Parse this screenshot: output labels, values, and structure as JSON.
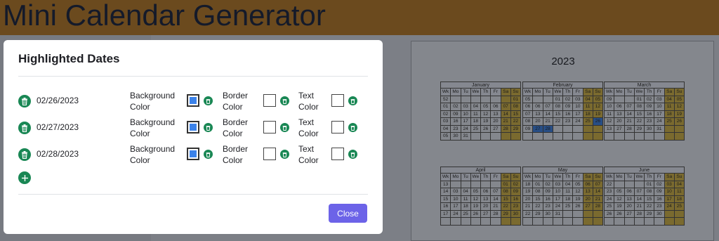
{
  "app": {
    "title": "Mini Calendar Generator"
  },
  "modal": {
    "title": "Highlighted Dates",
    "close_label": "Close",
    "rows": [
      {
        "date": "02/26/2023",
        "bg_label": "Background Color",
        "bg_color": "#3b82ea",
        "border_label": "Border Color",
        "text_label": "Text Color"
      },
      {
        "date": "02/27/2023",
        "bg_label": "Background Color",
        "bg_color": "#3b82ea",
        "border_label": "Border Color",
        "text_label": "Text Color"
      },
      {
        "date": "02/28/2023",
        "bg_label": "Background Color",
        "bg_color": "#3b82ea",
        "border_label": "Border Color",
        "text_label": "Text Color"
      }
    ]
  },
  "calendar": {
    "year": "2023",
    "weekday_headers": [
      "Wk",
      "Mo",
      "Tu",
      "We",
      "Th",
      "Fr",
      "Sa",
      "Su"
    ],
    "months": [
      {
        "name": "January",
        "weeks": [
          [
            "52",
            "",
            "",
            "",
            "",
            "",
            "",
            "01"
          ],
          [
            "01",
            "02",
            "03",
            "04",
            "05",
            "06",
            "07",
            "08"
          ],
          [
            "02",
            "09",
            "10",
            "11",
            "12",
            "13",
            "14",
            "15"
          ],
          [
            "03",
            "16",
            "17",
            "18",
            "19",
            "20",
            "21",
            "22"
          ],
          [
            "04",
            "23",
            "24",
            "25",
            "26",
            "27",
            "28",
            "29"
          ],
          [
            "05",
            "30",
            "31",
            "",
            "",
            "",
            "",
            ""
          ]
        ]
      },
      {
        "name": "February",
        "weeks": [
          [
            "05",
            "",
            "",
            "01",
            "02",
            "03",
            "04",
            "05"
          ],
          [
            "06",
            "06",
            "07",
            "08",
            "09",
            "10",
            "11",
            "12"
          ],
          [
            "07",
            "13",
            "14",
            "15",
            "16",
            "17",
            "18",
            "19"
          ],
          [
            "08",
            "20",
            "21",
            "22",
            "23",
            "24",
            "25",
            "26"
          ],
          [
            "09",
            "27",
            "28",
            "",
            "",
            "",
            "",
            ""
          ],
          [
            "",
            "",
            "",
            "",
            "",
            "",
            "",
            ""
          ]
        ]
      },
      {
        "name": "March",
        "weeks": [
          [
            "09",
            "",
            "",
            "01",
            "02",
            "03",
            "04",
            "05"
          ],
          [
            "10",
            "06",
            "07",
            "08",
            "09",
            "10",
            "11",
            "12"
          ],
          [
            "11",
            "13",
            "14",
            "15",
            "16",
            "17",
            "18",
            "19"
          ],
          [
            "12",
            "20",
            "21",
            "22",
            "23",
            "24",
            "25",
            "26"
          ],
          [
            "13",
            "27",
            "28",
            "29",
            "30",
            "31",
            "",
            ""
          ],
          [
            "",
            "",
            "",
            "",
            "",
            "",
            "",
            ""
          ]
        ]
      },
      {
        "name": "April",
        "weeks": [
          [
            "13",
            "",
            "",
            "",
            "",
            "",
            "01",
            "02"
          ],
          [
            "14",
            "03",
            "04",
            "05",
            "06",
            "07",
            "08",
            "09"
          ],
          [
            "15",
            "10",
            "11",
            "12",
            "13",
            "14",
            "15",
            "16"
          ],
          [
            "16",
            "17",
            "18",
            "19",
            "20",
            "21",
            "22",
            "23"
          ],
          [
            "17",
            "24",
            "25",
            "26",
            "27",
            "28",
            "29",
            "30"
          ],
          [
            "",
            "",
            "",
            "",
            "",
            "",
            "",
            ""
          ]
        ]
      },
      {
        "name": "May",
        "weeks": [
          [
            "18",
            "01",
            "02",
            "03",
            "04",
            "05",
            "06",
            "07"
          ],
          [
            "19",
            "08",
            "09",
            "10",
            "11",
            "12",
            "13",
            "14"
          ],
          [
            "20",
            "15",
            "16",
            "17",
            "18",
            "19",
            "20",
            "21"
          ],
          [
            "21",
            "22",
            "23",
            "24",
            "25",
            "26",
            "27",
            "28"
          ],
          [
            "22",
            "29",
            "30",
            "31",
            "",
            "",
            "",
            ""
          ],
          [
            "",
            "",
            "",
            "",
            "",
            "",
            "",
            ""
          ]
        ]
      },
      {
        "name": "June",
        "weeks": [
          [
            "22",
            "",
            "",
            "",
            "01",
            "02",
            "03",
            "04"
          ],
          [
            "23",
            "05",
            "06",
            "07",
            "08",
            "09",
            "10",
            "11"
          ],
          [
            "24",
            "12",
            "13",
            "14",
            "15",
            "16",
            "17",
            "18"
          ],
          [
            "25",
            "19",
            "20",
            "21",
            "22",
            "23",
            "24",
            "25"
          ],
          [
            "26",
            "26",
            "27",
            "28",
            "29",
            "30",
            "",
            ""
          ],
          [
            "",
            "",
            "",
            "",
            "",
            "",
            "",
            ""
          ]
        ]
      }
    ],
    "highlighted": {
      "month": "February",
      "days": [
        "26",
        "27",
        "28"
      ],
      "color": "#274e86"
    },
    "weekend_color": "#7a6a2f"
  }
}
